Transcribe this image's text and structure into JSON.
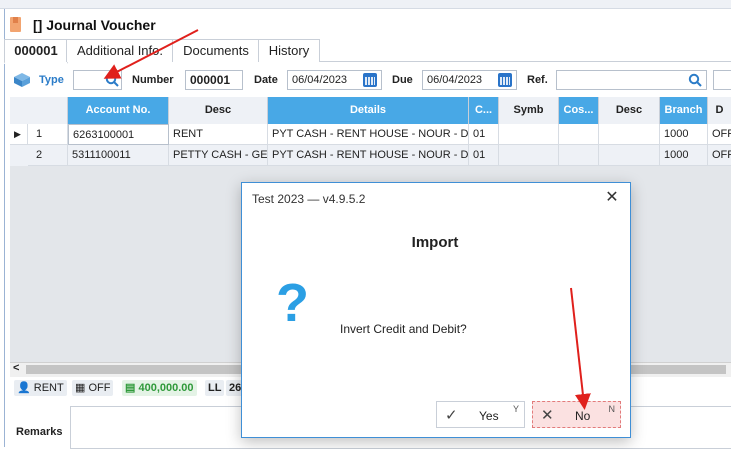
{
  "window": {
    "title": "[] Journal Voucher"
  },
  "tabs": [
    {
      "label": "000001"
    },
    {
      "label": "Additional Info."
    },
    {
      "label": "Documents"
    },
    {
      "label": "History"
    }
  ],
  "filters": {
    "type_label": "Type",
    "number_label": "Number",
    "number_value": "000001",
    "date_label": "Date",
    "date_value": "06/04/2023",
    "due_label": "Due",
    "due_value": "06/04/2023",
    "ref_label": "Ref."
  },
  "grid": {
    "headers": [
      "Account No.",
      "Desc",
      "Details",
      "C...",
      "Symb",
      "Cos...",
      "Desc",
      "Branch",
      "D"
    ],
    "rows": [
      {
        "num": "1",
        "account": "6263100001",
        "desc": "RENT",
        "details": "PYT CASH - RENT HOUSE - NOUR - D...",
        "c": "01",
        "branch": "1000",
        "d": "OFF"
      },
      {
        "num": "2",
        "account": "5311100011",
        "desc": "PETTY CASH - GE...",
        "details": "PYT CASH - RENT HOUSE - NOUR - D...",
        "c": "01",
        "branch": "1000",
        "d": "OFF"
      }
    ]
  },
  "status": {
    "left_arrow": "<",
    "user": "RENT",
    "office": "OFF",
    "amount": "400,000.00",
    "currency": "LL",
    "count": "26"
  },
  "remarks": {
    "label": "Remarks"
  },
  "dialog": {
    "title": "Test 2023 — v4.9.5.2",
    "heading": "Import",
    "message": "Invert Credit and Debit?",
    "yes_label": "Yes",
    "yes_key": "Y",
    "no_label": "No",
    "no_key": "N"
  },
  "colors": {
    "accent": "#48a8e6",
    "dialog_border": "#3f8fd6",
    "annotation_arrow": "#e0201c",
    "no_button_bg": "#fbe1e1",
    "amount_green": "#2f9a3a"
  }
}
